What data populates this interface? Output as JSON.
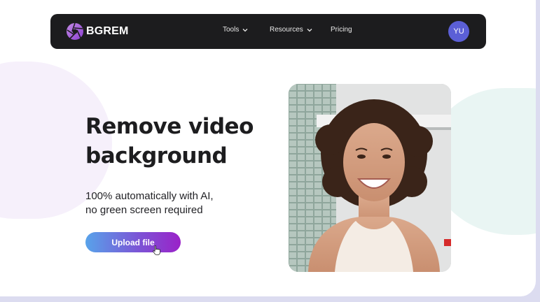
{
  "brand": {
    "name": "BGREM",
    "logo_icon": "aperture-logo-icon"
  },
  "nav": {
    "items": [
      {
        "label": "Tools",
        "has_dropdown": true
      },
      {
        "label": "Resources",
        "has_dropdown": true
      },
      {
        "label": "Pricing",
        "has_dropdown": false
      }
    ],
    "avatar_initials": "YU"
  },
  "hero": {
    "title_line1": "Remove video",
    "title_line2": "background",
    "subtitle_line1": "100% automatically with AI,",
    "subtitle_line2": "no green screen required",
    "upload_label": "Upload file"
  },
  "colors": {
    "navbar": "#1c1c1e",
    "avatar": "#5b5fd6",
    "button_gradient_start": "#58a3ea",
    "button_gradient_end": "#9a22c8"
  }
}
